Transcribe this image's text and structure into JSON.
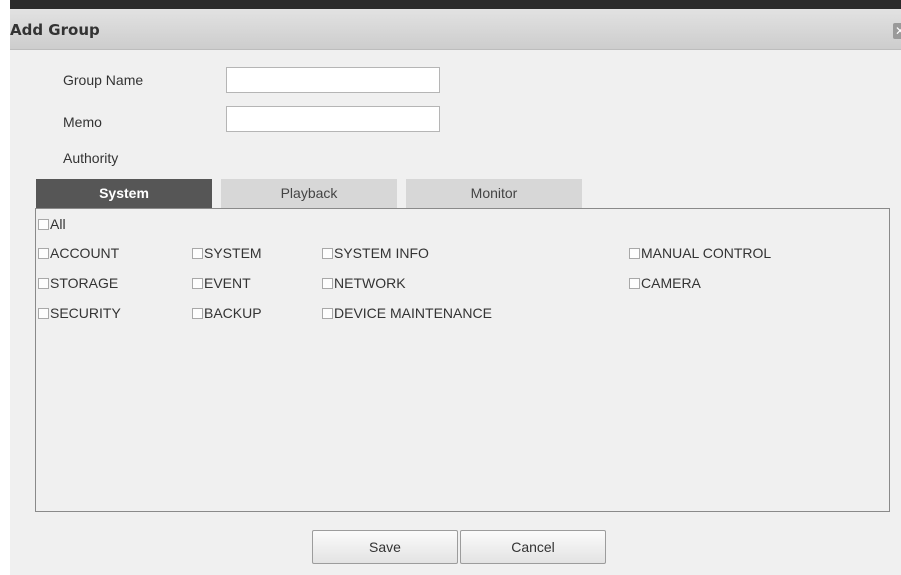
{
  "dialog": {
    "title": "Add Group",
    "close_glyph": "✕"
  },
  "form": {
    "group_name_label": "Group Name",
    "group_name_value": "",
    "memo_label": "Memo",
    "memo_value": "",
    "authority_label": "Authority"
  },
  "tabs": [
    {
      "label": "System",
      "active": true
    },
    {
      "label": "Playback",
      "active": false
    },
    {
      "label": "Monitor",
      "active": false
    }
  ],
  "permissions": {
    "all": {
      "label": "All",
      "checked": false
    },
    "items": [
      {
        "label": "ACCOUNT",
        "checked": false
      },
      {
        "label": "SYSTEM",
        "checked": false
      },
      {
        "label": "SYSTEM INFO",
        "checked": false
      },
      {
        "label": "MANUAL CONTROL",
        "checked": false
      },
      {
        "label": "STORAGE",
        "checked": false
      },
      {
        "label": "EVENT",
        "checked": false
      },
      {
        "label": "NETWORK",
        "checked": false
      },
      {
        "label": "CAMERA",
        "checked": false
      },
      {
        "label": "SECURITY",
        "checked": false
      },
      {
        "label": "BACKUP",
        "checked": false
      },
      {
        "label": "DEVICE MAINTENANCE",
        "checked": false
      }
    ]
  },
  "buttons": {
    "save": "Save",
    "cancel": "Cancel"
  }
}
